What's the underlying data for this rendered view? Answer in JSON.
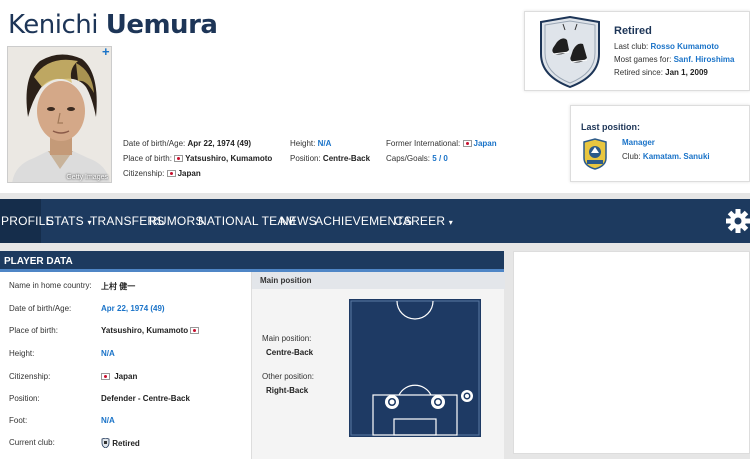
{
  "player": {
    "first_name": "Kenichi",
    "last_name": "Uemura",
    "photo_credit": "Getty Images",
    "add_icon": "+"
  },
  "header_facts": {
    "dob_label": "Date of birth/Age:",
    "dob_value": "Apr 22, 1974 (49)",
    "pob_label": "Place of birth:",
    "pob_value": "Yatsushiro, Kumamoto",
    "citizenship_label": "Citizenship:",
    "citizenship_value": "Japan",
    "height_label": "Height:",
    "height_value": "N/A",
    "position_label": "Position:",
    "position_value": "Centre-Back",
    "former_label": "Former International:",
    "former_value": "Japan",
    "caps_label": "Caps/Goals:",
    "caps_value": "5 / 0"
  },
  "retired_box": {
    "title": "Retired",
    "last_club_label": "Last club:",
    "last_club_value": "Rosso Kumamoto",
    "most_games_label": "Most games for:",
    "most_games_value": "Sanf. Hiroshima",
    "since_label": "Retired since:",
    "since_value": "Jan 1, 2009"
  },
  "last_position_box": {
    "title": "Last position:",
    "role": "Manager",
    "club_label": "Club:",
    "club_value": "Kamatam. Sanuki"
  },
  "nav": {
    "tabs": [
      "PROFILE",
      "STATS",
      "TRANSFERS",
      "RUMORS",
      "NATIONAL TEAM",
      "NEWS",
      "ACHIEVEMENTS",
      "CAREER"
    ],
    "active": "PROFILE",
    "caret": "▾",
    "gear_icon": "gear-icon"
  },
  "player_data": {
    "heading": "PLAYER DATA",
    "rows": [
      {
        "label": "Name in home country:",
        "value": "上村 健一"
      },
      {
        "label": "Date of birth/Age:",
        "value": "Apr 22, 1974 (49)"
      },
      {
        "label": "Place of birth:",
        "value": "Yatsushiro, Kumamoto"
      },
      {
        "label": "Height:",
        "value": "N/A"
      },
      {
        "label": "Citizenship:",
        "value": "Japan"
      },
      {
        "label": "Position:",
        "value": "Defender - Centre-Back"
      },
      {
        "label": "Foot:",
        "value": "N/A"
      },
      {
        "label": "Current club:",
        "value": "Retired"
      }
    ]
  },
  "main_position": {
    "heading": "Main position",
    "main_label": "Main position:",
    "main_value": "Centre-Back",
    "other_label": "Other position:",
    "other_value": "Right-Back"
  },
  "colors": {
    "navy": "#1d3a5f",
    "link": "#1a73c8",
    "pitch": "#1e3a64"
  }
}
